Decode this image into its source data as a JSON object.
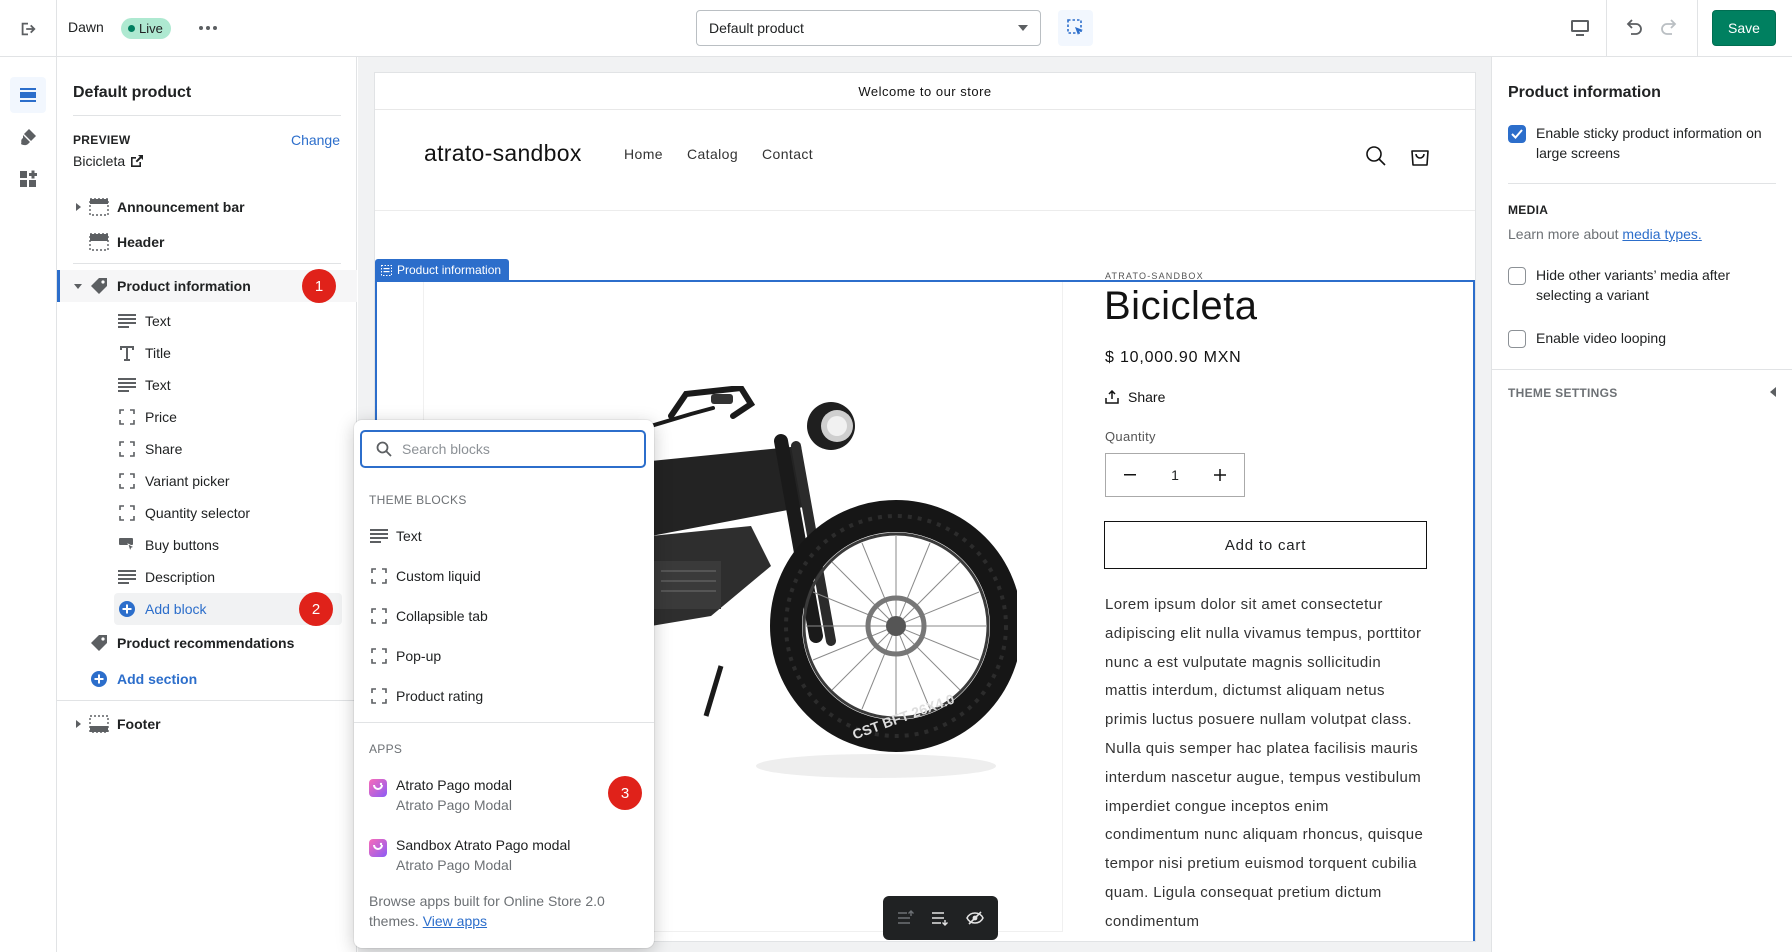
{
  "topbar": {
    "theme_name": "Dawn",
    "live_badge": "Live",
    "template_select": "Default product",
    "save_label": "Save"
  },
  "sidebar": {
    "title": "Default product",
    "preview_label": "PREVIEW",
    "change_label": "Change",
    "preview_value": "Bicicleta",
    "sections": {
      "announcement": "Announcement bar",
      "header": "Header",
      "product_info": "Product information",
      "product_recs": "Product recommendations",
      "add_section": "Add section",
      "footer": "Footer"
    },
    "blocks": [
      "Text",
      "Title",
      "Text",
      "Price",
      "Share",
      "Variant picker",
      "Quantity selector",
      "Buy buttons",
      "Description"
    ],
    "add_block": "Add block",
    "badges": [
      "1",
      "2",
      "3"
    ]
  },
  "store": {
    "announcement": "Welcome to our store",
    "logo": "atrato-sandbox",
    "nav": [
      "Home",
      "Catalog",
      "Contact"
    ],
    "section_tag": "Product information",
    "vendor": "ATRATO-SANDBOX",
    "title": "Bicicleta",
    "price": "$ 10,000.90 MXN",
    "share": "Share",
    "quantity_label": "Quantity",
    "quantity_value": "1",
    "add_to_cart": "Add to cart",
    "description": "Lorem ipsum dolor sit amet consectetur adipiscing elit nulla vivamus tempus, porttitor nunc a est vulputate magnis sollicitudin mattis interdum, dictumst aliquam netus primis luctus posuere nullam volutpat class. Nulla quis semper hac platea facilisis mauris interdum nascetur augue, tempus vestibulum imperdiet congue inceptos enim condimentum nunc aliquam rhoncus, quisque tempor nisi pretium euismod torquent cubilia quam. Ligula consequat pretium dictum condimentum"
  },
  "popover": {
    "search_placeholder": "Search blocks",
    "theme_blocks_heading": "THEME BLOCKS",
    "theme_blocks": [
      "Text",
      "Custom liquid",
      "Collapsible tab",
      "Pop-up",
      "Product rating"
    ],
    "apps_heading": "APPS",
    "apps": [
      {
        "name": "Atrato Pago modal",
        "sub": "Atrato Pago Modal"
      },
      {
        "name": "Sandbox Atrato Pago modal",
        "sub": "Atrato Pago Modal"
      }
    ],
    "footer_text": "Browse apps built for Online Store 2.0 themes.",
    "footer_link": "View apps"
  },
  "rpanel": {
    "title": "Product information",
    "sticky_label": "Enable sticky product information on large screens",
    "sticky_checked": true,
    "media_heading": "MEDIA",
    "media_help": "Learn more about",
    "media_link": "media types.",
    "hide_variants_label": "Hide other variants’ media after selecting a variant",
    "video_loop_label": "Enable video looping",
    "theme_settings": "THEME SETTINGS"
  },
  "colors": {
    "accent": "#2c6ecb",
    "save": "#008060",
    "badge": "#e0221a",
    "live": "#aee9d1"
  }
}
